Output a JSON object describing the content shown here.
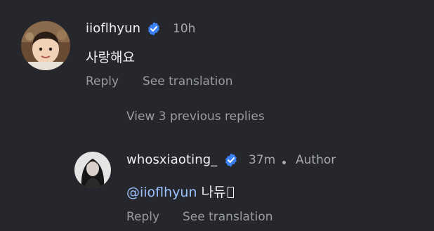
{
  "colors": {
    "background": "#25272c",
    "text_primary": "#f1f1f1",
    "text_secondary": "#9a9ca1",
    "mention": "#9cc3ff",
    "verified_badge": "#3b82f6"
  },
  "comment": {
    "username": "iioflhyun",
    "verified_icon": "verified-badge-icon",
    "time": "10h",
    "text": "사랑해요",
    "reply_label": "Reply",
    "translate_label": "See translation"
  },
  "view_previous_replies": "View 3 previous replies",
  "reply": {
    "username": "whosxiaoting_",
    "verified_icon": "verified-badge-icon",
    "time": "37m",
    "role": "Author",
    "mention": "@iioflhyun",
    "text": "나듀\u0000",
    "text_display": "나듀",
    "reply_label": "Reply",
    "translate_label": "See translation"
  }
}
